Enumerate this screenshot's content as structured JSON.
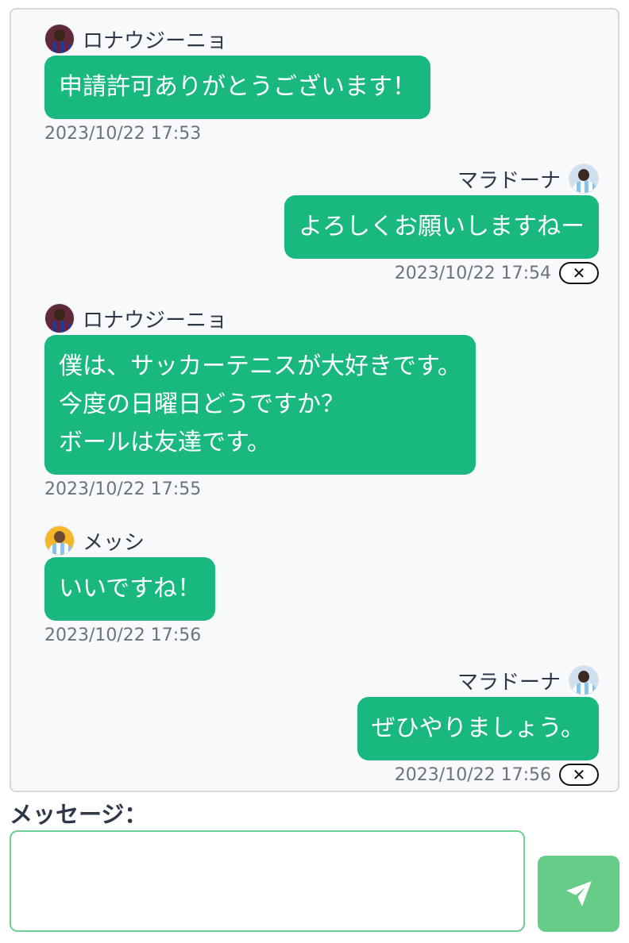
{
  "messages": [
    {
      "user": "ロナウジーニョ",
      "avatar": "ronaldinho-avatar",
      "side": "left",
      "lines": [
        "申請許可ありがとうございます！"
      ],
      "time": "2023/10/22 17:53"
    },
    {
      "user": "マラドーナ",
      "avatar": "maradona-avatar",
      "side": "right",
      "lines": [
        "よろしくお願いしますねー"
      ],
      "time": "2023/10/22 17:54",
      "delete_label": "✕"
    },
    {
      "user": "ロナウジーニョ",
      "avatar": "ronaldinho-avatar",
      "side": "left",
      "lines": [
        "僕は、サッカーテニスが大好きです。",
        "今度の日曜日どうですか？",
        "ボールは友達です。"
      ],
      "time": "2023/10/22 17:55"
    },
    {
      "user": "メッシ",
      "avatar": "messi-avatar",
      "side": "left",
      "lines": [
        "いいですね！"
      ],
      "time": "2023/10/22 17:56"
    },
    {
      "user": "マラドーナ",
      "avatar": "maradona-avatar",
      "side": "right",
      "lines": [
        "ぜひやりましょう。"
      ],
      "time": "2023/10/22 17:56",
      "delete_label": "✕"
    }
  ],
  "form": {
    "label": "メッセージ：",
    "input_value": "",
    "input_placeholder": "",
    "send_icon": "paper-plane-icon"
  },
  "colors": {
    "bubble": "#19b87f",
    "send_button": "#66cc88",
    "input_border": "#6dce8f"
  }
}
